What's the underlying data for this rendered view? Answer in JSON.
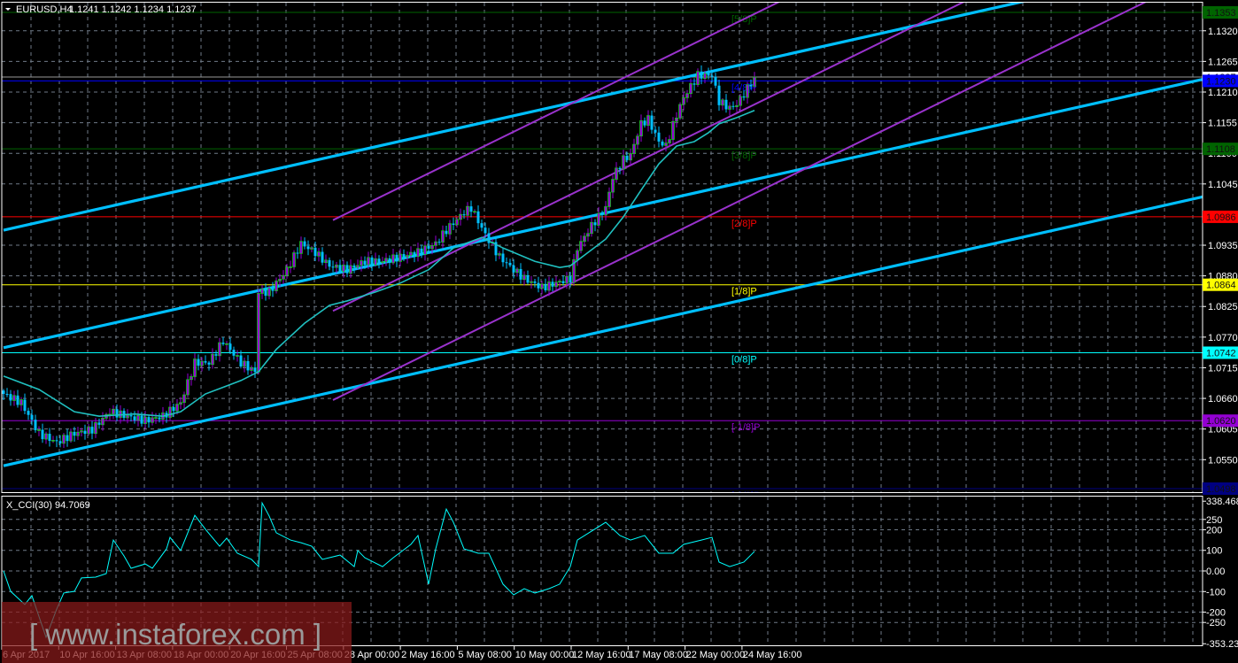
{
  "header": {
    "symbol": "EURUSD,H4",
    "ohlc": "1.1241 1.1242 1.1234 1.1237"
  },
  "price_axis": {
    "ticks": [
      "1.1320",
      "1.1265",
      "1.1210",
      "1.1155",
      "1.1100",
      "1.1045",
      "1.0935",
      "1.0880",
      "1.0825",
      "1.0770",
      "1.0715",
      "1.0660",
      "1.0605",
      "1.0550"
    ]
  },
  "current_price": {
    "label": "1.1237",
    "value": 1.1237
  },
  "murrey": [
    {
      "label": "[5/8]P",
      "price": 1.1353,
      "price_label": "1.1353",
      "color": "#006400"
    },
    {
      "label": "[4/8]P",
      "price": 1.123,
      "price_label": "1.1230",
      "color": "#0000FF"
    },
    {
      "label": "[3/8]P",
      "price": 1.1108,
      "price_label": "1.1108",
      "color": "#006400"
    },
    {
      "label": "[2/8]P",
      "price": 1.0986,
      "price_label": "1.0986",
      "color": "#FF0000"
    },
    {
      "label": "[1/8]P",
      "price": 1.0864,
      "price_label": "1.0864",
      "color": "#FFFF00"
    },
    {
      "label": "[0/8]P",
      "price": 1.0742,
      "price_label": "1.0742",
      "color": "#00FFFF"
    },
    {
      "label": "[-1/8]P",
      "price": 1.062,
      "price_label": "1.0620",
      "color": "#9400D3"
    },
    {
      "label": "[-2/8]P",
      "price": 1.0498,
      "price_label": "1.0498",
      "color": "#000080"
    }
  ],
  "cci": {
    "title": "X_CCI(30) 94.7069",
    "ticks": [
      "338.4682",
      "250",
      "200",
      "100",
      "0.00",
      "-100",
      "-200",
      "-250",
      "-353.231"
    ],
    "color": "#00FFFF"
  },
  "time_axis": [
    "6 Apr 2017",
    "10 Apr 16:00",
    "13 Apr 08:00",
    "18 Apr 00:00",
    "20 Apr 16:00",
    "25 Apr 08:00",
    "28 Apr 00:00",
    "2 May 16:00",
    "5 May 08:00",
    "10 May 00:00",
    "12 May 16:00",
    "17 May 08:00",
    "22 May 00:00",
    "24 May 16:00"
  ],
  "watermark": "[ www.instaforex.com ]",
  "chart_data": {
    "type": "candlestick",
    "title": "EURUSD,H4",
    "ylim": [
      1.0498,
      1.1353
    ],
    "colors": {
      "bull": "#9400D3",
      "bull_edge": "#00FF00",
      "bear": "#00BFFF",
      "ma": "#20C0C0",
      "trend": "#00BFFF",
      "channel": "#9932CC"
    },
    "close_path": [
      [
        0,
        1.0668
      ],
      [
        5,
        1.0652
      ],
      [
        10,
        1.0597
      ],
      [
        15,
        1.0581
      ],
      [
        20,
        1.0597
      ],
      [
        25,
        1.0604
      ],
      [
        30,
        1.0636
      ],
      [
        35,
        1.0628
      ],
      [
        40,
        1.062
      ],
      [
        45,
        1.0628
      ],
      [
        50,
        1.0652
      ],
      [
        54,
        1.0724
      ],
      [
        58,
        1.0724
      ],
      [
        62,
        1.0763
      ],
      [
        67,
        1.0724
      ],
      [
        71,
        1.0708
      ],
      [
        72,
        1.0851
      ],
      [
        75,
        1.0851
      ],
      [
        80,
        1.0891
      ],
      [
        84,
        1.0938
      ],
      [
        88,
        1.0922
      ],
      [
        92,
        1.0898
      ],
      [
        97,
        1.0891
      ],
      [
        102,
        1.0906
      ],
      [
        107,
        1.0906
      ],
      [
        112,
        1.0914
      ],
      [
        117,
        1.0922
      ],
      [
        122,
        1.0938
      ],
      [
        125,
        1.0962
      ],
      [
        130,
        1.0994
      ],
      [
        132,
        1.1002
      ],
      [
        136,
        1.0954
      ],
      [
        140,
        1.0914
      ],
      [
        144,
        1.0891
      ],
      [
        147,
        1.0875
      ],
      [
        152,
        1.0859
      ],
      [
        156,
        1.0867
      ],
      [
        160,
        1.0875
      ],
      [
        162,
        1.093
      ],
      [
        166,
        1.097
      ],
      [
        170,
        1.1002
      ],
      [
        172,
        1.1057
      ],
      [
        175,
        1.1089
      ],
      [
        177,
        1.1097
      ],
      [
        180,
        1.1153
      ],
      [
        182,
        1.1161
      ],
      [
        185,
        1.1121
      ],
      [
        187,
        1.1113
      ],
      [
        190,
        1.1169
      ],
      [
        192,
        1.12
      ],
      [
        196,
        1.124
      ],
      [
        200,
        1.124
      ],
      [
        202,
        1.1193
      ],
      [
        205,
        1.1181
      ],
      [
        207,
        1.1188
      ],
      [
        210,
        1.1216
      ],
      [
        212,
        1.1237
      ]
    ],
    "ma_path": [
      [
        0,
        1.07
      ],
      [
        10,
        1.0676
      ],
      [
        20,
        1.0636
      ],
      [
        27,
        1.0628
      ],
      [
        37,
        1.0632
      ],
      [
        45,
        1.0628
      ],
      [
        50,
        1.0636
      ],
      [
        57,
        1.0668
      ],
      [
        67,
        1.0692
      ],
      [
        72,
        1.0708
      ],
      [
        77,
        1.0748
      ],
      [
        85,
        1.0795
      ],
      [
        92,
        1.0827
      ],
      [
        97,
        1.0835
      ],
      [
        105,
        1.0851
      ],
      [
        112,
        1.0867
      ],
      [
        120,
        1.0891
      ],
      [
        127,
        1.093
      ],
      [
        135,
        1.0949
      ],
      [
        141,
        1.093
      ],
      [
        150,
        1.0906
      ],
      [
        157,
        1.0895
      ],
      [
        160,
        1.0898
      ],
      [
        165,
        1.0922
      ],
      [
        170,
        1.0946
      ],
      [
        175,
        1.0986
      ],
      [
        180,
        1.1034
      ],
      [
        185,
        1.1081
      ],
      [
        190,
        1.1113
      ],
      [
        195,
        1.1121
      ],
      [
        199,
        1.1137
      ],
      [
        202,
        1.1153
      ],
      [
        207,
        1.1164
      ],
      [
        212,
        1.1177
      ]
    ],
    "trend_lines": [
      [
        [
          0,
          1.0962
        ],
        [
          340,
          1.1447
        ]
      ],
      [
        [
          0,
          1.0751
        ],
        [
          340,
          1.1235
        ]
      ],
      [
        [
          0,
          1.0539
        ],
        [
          340,
          1.1024
        ]
      ]
    ],
    "channel_lines": [
      [
        [
          93,
          1.098
        ],
        [
          339.5,
          1.1747
        ]
      ],
      [
        [
          93,
          1.0817
        ],
        [
          339.5,
          1.1585
        ]
      ],
      [
        [
          93,
          1.0657
        ],
        [
          339.5,
          1.1425
        ]
      ]
    ],
    "cci_ylim": [
      -353.231,
      338.4682
    ],
    "cci_path": [
      [
        0,
        0
      ],
      [
        2,
        -99
      ],
      [
        6,
        -163
      ],
      [
        8,
        -120
      ],
      [
        12,
        -322
      ],
      [
        15,
        -185
      ],
      [
        17,
        -107
      ],
      [
        20,
        -99
      ],
      [
        22,
        -34
      ],
      [
        26,
        -30
      ],
      [
        29,
        -13
      ],
      [
        31,
        150
      ],
      [
        34,
        73
      ],
      [
        36,
        13
      ],
      [
        40,
        34
      ],
      [
        42,
        13
      ],
      [
        46,
        107
      ],
      [
        47,
        163
      ],
      [
        50,
        99
      ],
      [
        54,
        270
      ],
      [
        57,
        202
      ],
      [
        61,
        120
      ],
      [
        63,
        159
      ],
      [
        66,
        86
      ],
      [
        70,
        56
      ],
      [
        72,
        21
      ],
      [
        73,
        330
      ],
      [
        75,
        266
      ],
      [
        77,
        185
      ],
      [
        81,
        150
      ],
      [
        84,
        137
      ],
      [
        87,
        120
      ],
      [
        90,
        56
      ],
      [
        95,
        77
      ],
      [
        99,
        21
      ],
      [
        100,
        99
      ],
      [
        102,
        64
      ],
      [
        107,
        21
      ],
      [
        110,
        64
      ],
      [
        115,
        129
      ],
      [
        117,
        172
      ],
      [
        120,
        -64
      ],
      [
        122,
        107
      ],
      [
        125,
        300
      ],
      [
        127,
        236
      ],
      [
        130,
        107
      ],
      [
        134,
        86
      ],
      [
        137,
        86
      ],
      [
        141,
        -64
      ],
      [
        144,
        -116
      ],
      [
        147,
        -86
      ],
      [
        150,
        -107
      ],
      [
        154,
        -86
      ],
      [
        157,
        -64
      ],
      [
        160,
        21
      ],
      [
        162,
        150
      ],
      [
        166,
        193
      ],
      [
        170,
        236
      ],
      [
        174,
        172
      ],
      [
        177,
        150
      ],
      [
        181,
        172
      ],
      [
        185,
        86
      ],
      [
        189,
        86
      ],
      [
        192,
        129
      ],
      [
        197,
        150
      ],
      [
        200,
        163
      ],
      [
        202,
        43
      ],
      [
        205,
        21
      ],
      [
        209,
        43
      ],
      [
        212,
        94.7
      ]
    ]
  }
}
